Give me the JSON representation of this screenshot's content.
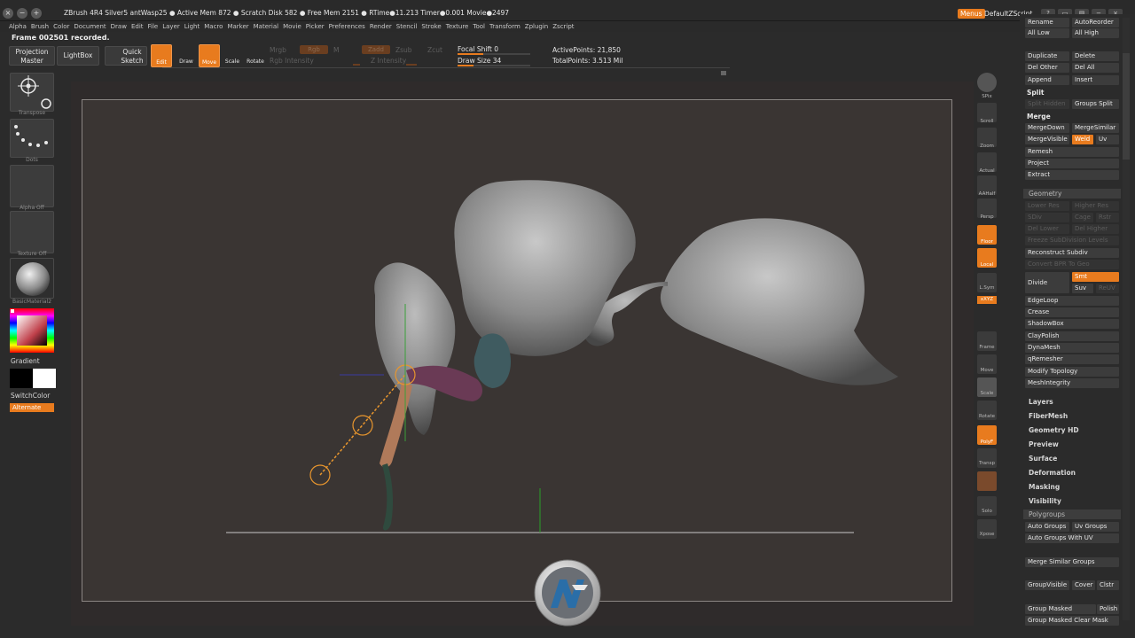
{
  "titlebar": {
    "title": "ZBrush 4R4 Silver5    antWasp25    ● Active Mem 872  ● Scratch Disk 582  ● Free Mem 2151  ● RTime●11.213  Timer●0.001  Movie●2497",
    "menus": "Menus",
    "script": "DefaultZScript"
  },
  "menubar": [
    "Alpha",
    "Brush",
    "Color",
    "Document",
    "Draw",
    "Edit",
    "File",
    "Layer",
    "Light",
    "Macro",
    "Marker",
    "Material",
    "Movie",
    "Picker",
    "Preferences",
    "Render",
    "Stencil",
    "Stroke",
    "Texture",
    "Tool",
    "Transform",
    "Zplugin",
    "Zscript"
  ],
  "notice": "Frame 002501 recorded.",
  "shelf": {
    "projection_master": "Projection Master",
    "lightbox": "LightBox",
    "quick_sketch": "Quick Sketch",
    "edit": "Edit",
    "draw": "Draw",
    "move": "Move",
    "scale": "Scale",
    "rotate": "Rotate",
    "mrgb": "Mrgb",
    "rgb": "Rgb",
    "m": "M",
    "rgb_intensity": "Rgb Intensity",
    "zadd": "Zadd",
    "zsub": "Zsub",
    "zcut": "Zcut",
    "z_intensity": "Z Intensity",
    "focal_shift": "Focal Shift 0",
    "draw_size": "Draw Size 34",
    "focal_fill": 0.35,
    "draw_fill": 0.22,
    "active_points": "ActivePoints: 21,850",
    "total_points": "TotalPoints: 3.513 Mil"
  },
  "left": {
    "transpose": "Transpose",
    "dots": "Dots",
    "alpha": "Alpha  Off",
    "texture": "Texture  Off",
    "material": "BasicMaterial2",
    "gradient": "Gradient",
    "switchcolor": "SwitchColor",
    "alternate": "Alternate"
  },
  "rightshelf": [
    "BPR",
    "SPix",
    "Scroll",
    "Zoom",
    "Actual",
    "AAHalf",
    "Persp",
    "Floor",
    "Local",
    "L.Sym",
    "xXYZ",
    "",
    "Frame",
    "Move",
    "Scale",
    "Rotate",
    "PolyF",
    "Transp",
    "Ghost",
    "Solo",
    "Xpose"
  ],
  "tray": {
    "rename": "Rename",
    "autoreorder": "AutoReorder",
    "all_low": "All Low",
    "all_high": "All High",
    "duplicate": "Duplicate",
    "delete": "Delete",
    "del_other": "Del Other",
    "del_all": "Del All",
    "append": "Append",
    "insert": "Insert",
    "split": "Split",
    "split_hidden": "Split Hidden",
    "groups_split": "Groups Split",
    "merge": "Merge",
    "mergedown": "MergeDown",
    "mergesimilar": "MergeSimilar",
    "mergevisible": "MergeVisible",
    "weld": "Weld",
    "uv": "Uv",
    "remesh": "Remesh",
    "project": "Project",
    "extract": "Extract",
    "geometry": "Geometry",
    "lower_res": "Lower Res",
    "higher_res": "Higher Res",
    "sdiv": "SDiv",
    "cage": "Cage",
    "rstr": "Rstr",
    "del_lower": "Del Lower",
    "del_higher": "Del Higher",
    "freeze": "Freeze SubDivision Levels",
    "reconstruct": "Reconstruct Subdiv",
    "convert_bpr": "Convert BPR To Geo",
    "divide": "Divide",
    "smt": "Smt",
    "suv": "Suv",
    "reluv": "ReUV",
    "edgeloop": "EdgeLoop",
    "crease": "Crease",
    "shadowbox": "ShadowBox",
    "claypolish": "ClayPolish",
    "dynamesh": "DynaMesh",
    "qremesher": "qRemesher",
    "modify_topology": "Modify Topology",
    "meshintegrity": "MeshIntegrity",
    "layers": "Layers",
    "fibermesh": "FiberMesh",
    "geometry_hd": "Geometry HD",
    "preview": "Preview",
    "surface": "Surface",
    "deformation": "Deformation",
    "masking": "Masking",
    "visibility": "Visibility",
    "polygroups": "Polygroups",
    "auto_groups": "Auto Groups",
    "uv_groups": "Uv Groups",
    "auto_groups_uv": "Auto Groups With UV",
    "merge_similar_groups": "Merge Similar Groups",
    "groupvisible": "GroupVisible",
    "coverage": "Cover",
    "clstr": "Clstr",
    "group_masked": "Group Masked",
    "polish": "Polish",
    "group_masked_clear": "Group Masked Clear Mask"
  },
  "colors": {
    "accent": "#e87b1e",
    "canvas": "#3a3533",
    "panel": "#2b2b2b"
  }
}
